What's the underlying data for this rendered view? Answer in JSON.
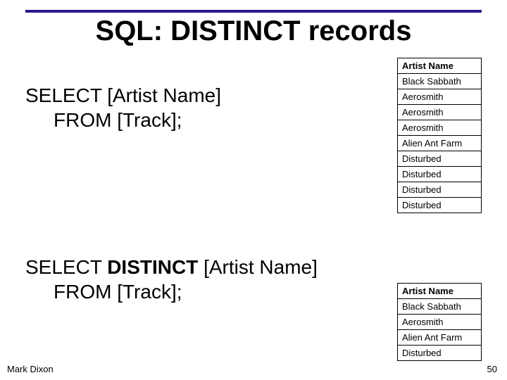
{
  "title": "SQL: DISTINCT records",
  "query1": {
    "line1": "SELECT [Artist Name]",
    "line2": "FROM [Track];"
  },
  "query2": {
    "prefix": "SELECT ",
    "distinct": "DISTINCT",
    "rest": " [Artist Name]",
    "line2": "FROM [Track];"
  },
  "tables": {
    "full": {
      "header": "Artist Name",
      "rows": [
        "Black Sabbath",
        "Aerosmith",
        "Aerosmith",
        "Aerosmith",
        "Alien Ant Farm",
        "Disturbed",
        "Disturbed",
        "Disturbed",
        "Disturbed"
      ]
    },
    "distinct": {
      "header": "Artist Name",
      "rows": [
        "Black Sabbath",
        "Aerosmith",
        "Alien Ant Farm",
        "Disturbed"
      ]
    }
  },
  "footer": {
    "author": "Mark Dixon",
    "page": "50"
  }
}
